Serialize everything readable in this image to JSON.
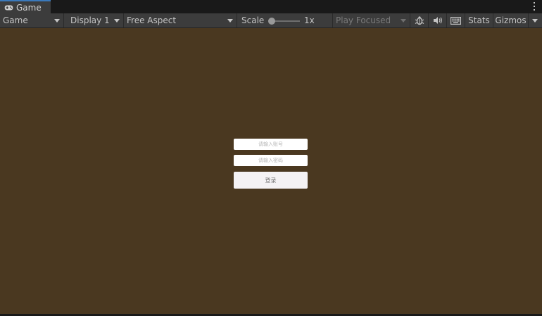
{
  "tab": {
    "title": "Game",
    "icon": "gamepad-icon"
  },
  "toolbar": {
    "view_select": "Game",
    "display_select": "Display 1",
    "aspect_select": "Free Aspect",
    "scale_label": "Scale",
    "scale_value": "1x",
    "scale_slider_level": 0,
    "play_mode_select": "Play Focused",
    "bug_icon": "bug-icon",
    "audio_icon": "speaker-icon",
    "keyboard_icon": "keyboard-icon",
    "stats_label": "Stats",
    "gizmos_label": "Gizmos"
  },
  "game": {
    "background_color": "#4a3820",
    "account_placeholder": "请输入账号",
    "password_placeholder": "请输入密码",
    "login_label": "登录"
  }
}
